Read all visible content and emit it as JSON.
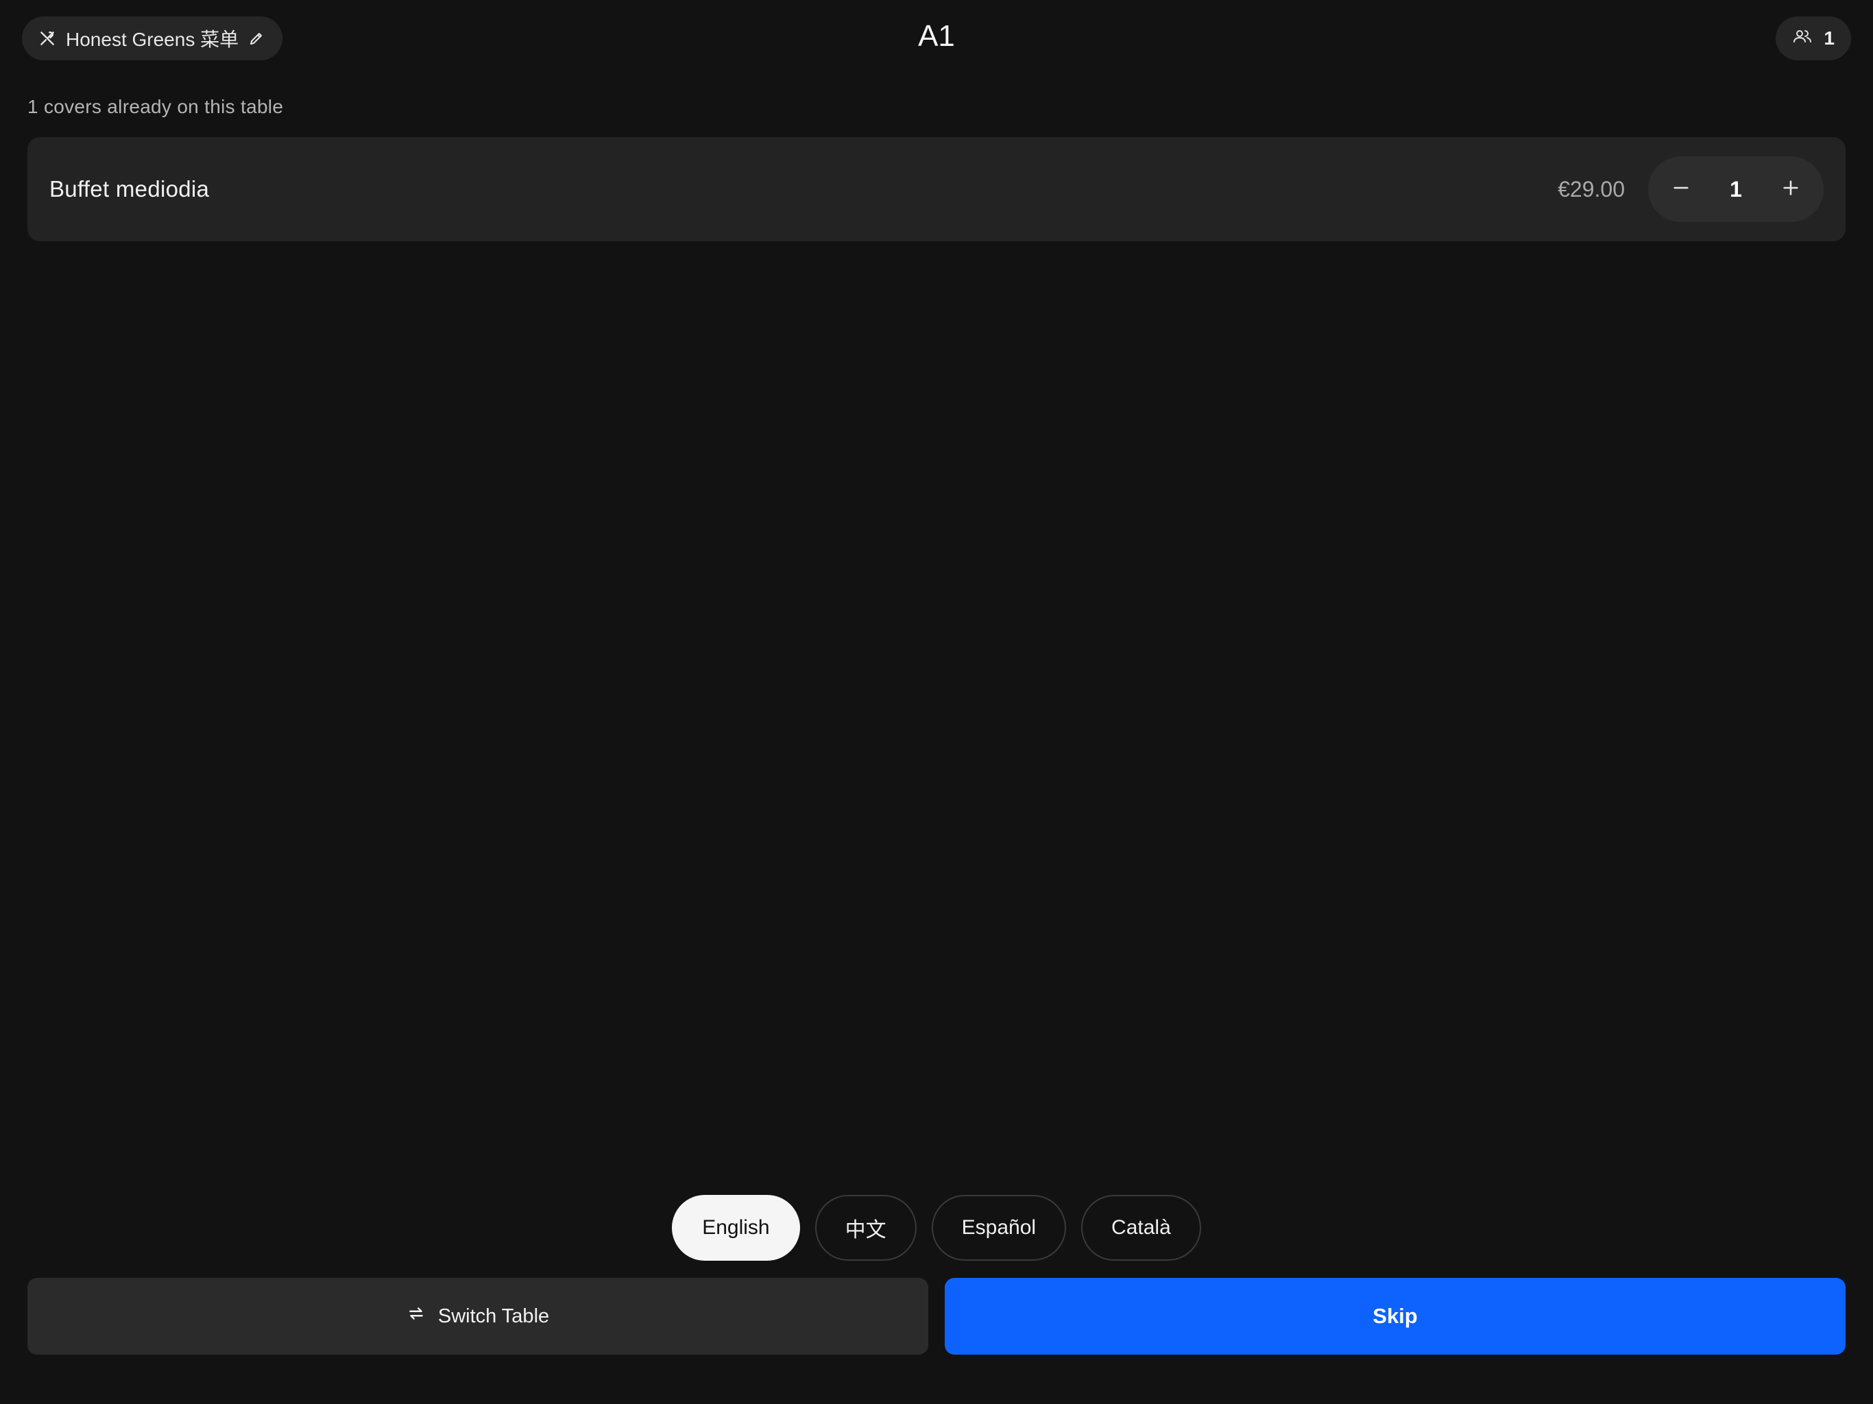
{
  "header": {
    "menu_name": "Honest Greens 菜单",
    "table_name": "A1",
    "guest_count": "1",
    "icons": {
      "menu": "utensils-icon",
      "edit": "pencil-icon",
      "guests": "users-icon"
    }
  },
  "covers_note": "1 covers already on this table",
  "items": [
    {
      "name": "Buffet mediodia",
      "price": "€29.00",
      "quantity": "1"
    }
  ],
  "languages": {
    "options": [
      "English",
      "中文",
      "Español",
      "Català"
    ],
    "selected": "English"
  },
  "actions": {
    "switch_table_label": "Switch Table",
    "switch_icon": "swap-arrows-icon",
    "skip_label": "Skip"
  },
  "colors": {
    "background": "#121212",
    "card": "#232323",
    "primary": "#0e62fd",
    "selected_chip": "#f5f5f5"
  }
}
